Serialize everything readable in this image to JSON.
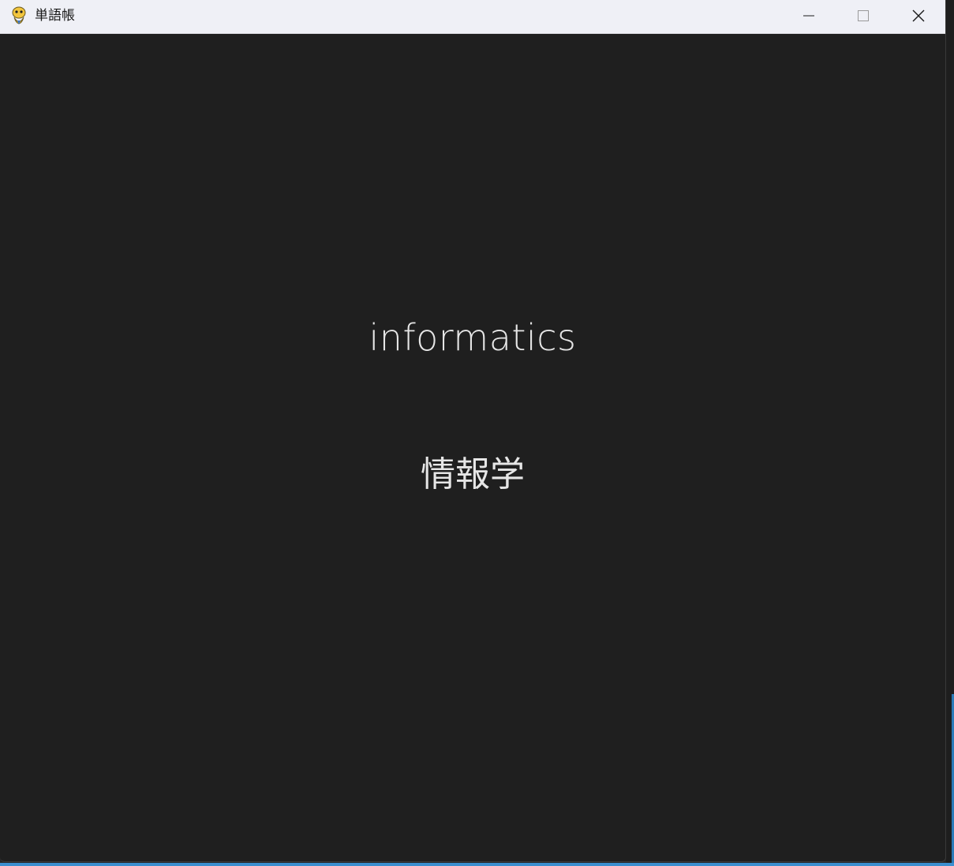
{
  "window": {
    "title": "単語帳",
    "icon": "pygame-snake-icon",
    "controls": {
      "minimize": "minimize-icon",
      "maximize": "maximize-icon",
      "close": "close-icon"
    }
  },
  "card": {
    "word": "informatics",
    "meaning": "情報学"
  },
  "colors": {
    "background": "#1f1f1f",
    "text": "#e6e6e6",
    "titlebar": "#eff0f6"
  }
}
